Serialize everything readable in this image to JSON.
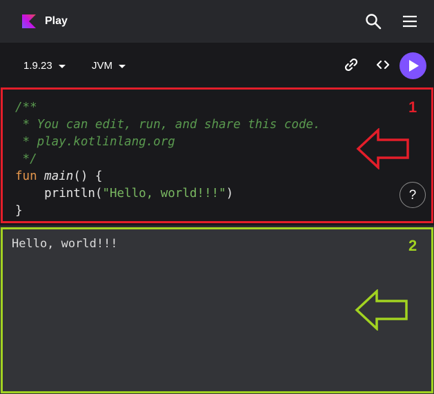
{
  "header": {
    "brand": "Play",
    "icons": [
      "kotlin-logo-icon",
      "search-icon",
      "menu-icon"
    ]
  },
  "toolbar": {
    "version": "1.9.23",
    "target": "JVM",
    "icons": [
      "link-icon",
      "code-icon",
      "run-icon"
    ]
  },
  "editor": {
    "lines": [
      [
        {
          "t": "/**",
          "k": "comment"
        }
      ],
      [
        {
          "t": " * You can edit, run, and share this code.",
          "k": "comment"
        }
      ],
      [
        {
          "t": " * play.kotlinlang.org",
          "k": "comment"
        }
      ],
      [
        {
          "t": " */",
          "k": "comment"
        }
      ],
      [
        {
          "t": "fun",
          "k": "keyword"
        },
        {
          "t": " ",
          "k": "plain"
        },
        {
          "t": "main",
          "k": "fn"
        },
        {
          "t": "() {",
          "k": "plain"
        }
      ],
      [
        {
          "t": "    println(",
          "k": "plain"
        },
        {
          "t": "\"Hello, world!!!\"",
          "k": "str"
        },
        {
          "t": ")",
          "k": "plain"
        }
      ],
      [
        {
          "t": "}",
          "k": "plain"
        }
      ]
    ],
    "marker": "1",
    "help_label": "?",
    "accent": "#e41e2a"
  },
  "output": {
    "text": "Hello, world!!!",
    "marker": "2",
    "accent": "#a2d321"
  },
  "colors": {
    "run_button": "#7f52ff",
    "comment": "#5a9a4f",
    "keyword": "#e4964c",
    "string": "#79b861"
  }
}
